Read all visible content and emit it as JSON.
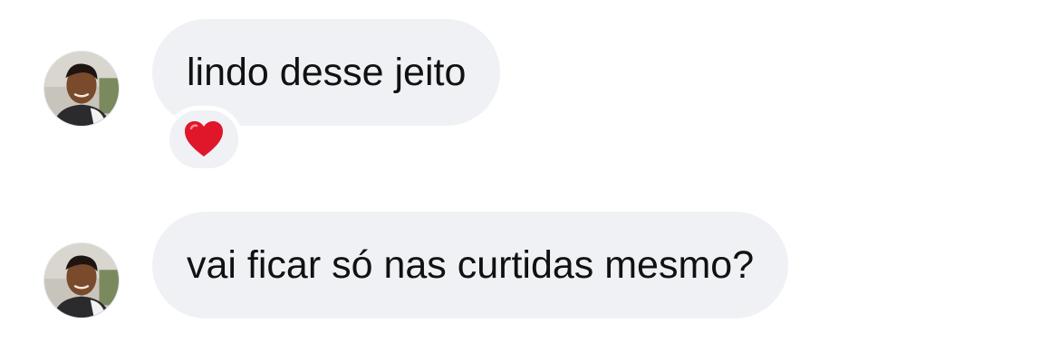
{
  "messages": [
    {
      "text": "lindo desse jeito",
      "reaction": {
        "emoji": "❤️",
        "icon": "red-heart-icon",
        "color": "#e0162b"
      }
    },
    {
      "text": "vai ficar só nas curtidas mesmo?"
    }
  ],
  "colors": {
    "bubble": "#eff1f4",
    "text": "#111111",
    "background": "#ffffff"
  }
}
